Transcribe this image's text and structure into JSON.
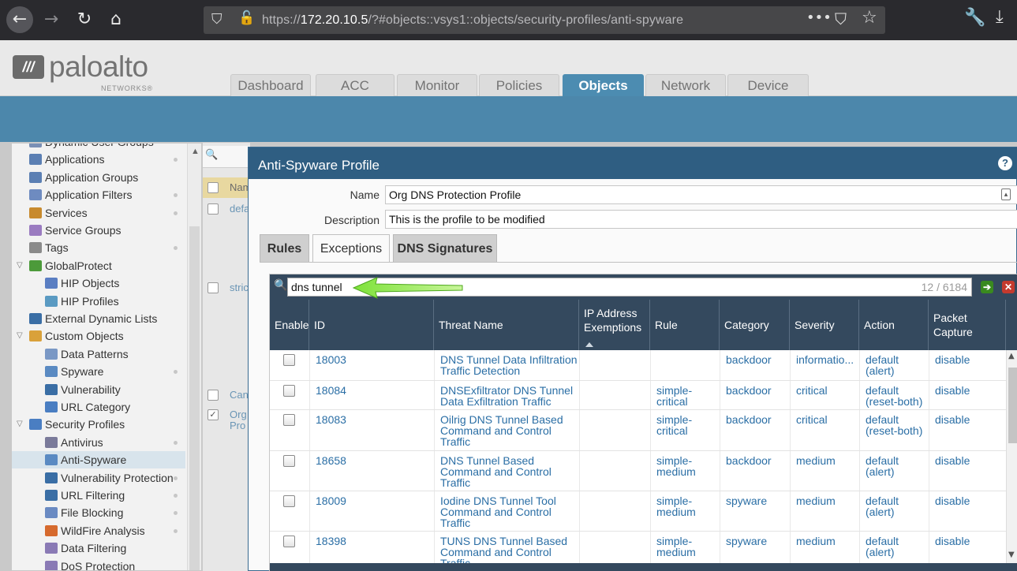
{
  "browser": {
    "url_prefix": "https://",
    "url_host": "172.20.10.5",
    "url_path": "/?#objects::vsys1::objects/security-profiles/anti-spyware",
    "icons": [
      "back-icon",
      "forward-icon",
      "reload-icon",
      "home-icon",
      "shield-icon",
      "lock-warning-icon",
      "more-icon",
      "pocket-icon",
      "star-icon",
      "wrench-icon",
      "download-icon"
    ]
  },
  "header": {
    "logo_text": "paloalto",
    "logo_sub": "NETWORKS®",
    "tabs": [
      {
        "label": "Dashboard"
      },
      {
        "label": "ACC"
      },
      {
        "label": "Monitor"
      },
      {
        "label": "Policies"
      },
      {
        "label": "Objects",
        "active": true
      },
      {
        "label": "Network"
      },
      {
        "label": "Device"
      }
    ]
  },
  "tree": {
    "items": [
      {
        "label": "Dynamic User Groups",
        "icon": "user-group-icon"
      },
      {
        "label": "Applications",
        "icon": "application-icon"
      },
      {
        "label": "Application Groups",
        "icon": "application-group-icon"
      },
      {
        "label": "Application Filters",
        "icon": "application-filter-icon"
      },
      {
        "label": "Services",
        "icon": "service-icon"
      },
      {
        "label": "Service Groups",
        "icon": "service-group-icon"
      },
      {
        "label": "Tags",
        "icon": "tag-icon"
      },
      {
        "label": "GlobalProtect",
        "icon": "globalprotect-icon"
      },
      {
        "label": "HIP Objects",
        "icon": "hip-object-icon"
      },
      {
        "label": "HIP Profiles",
        "icon": "hip-profile-icon"
      },
      {
        "label": "External Dynamic Lists",
        "icon": "external-list-icon"
      },
      {
        "label": "Custom Objects",
        "icon": "custom-object-icon"
      },
      {
        "label": "Data Patterns",
        "icon": "data-pattern-icon"
      },
      {
        "label": "Spyware",
        "icon": "spyware-icon"
      },
      {
        "label": "Vulnerability",
        "icon": "vulnerability-icon"
      },
      {
        "label": "URL Category",
        "icon": "url-category-icon"
      },
      {
        "label": "Security Profiles",
        "icon": "security-profile-icon"
      },
      {
        "label": "Antivirus",
        "icon": "antivirus-icon"
      },
      {
        "label": "Anti-Spyware",
        "icon": "anti-spyware-icon"
      },
      {
        "label": "Vulnerability Protection",
        "icon": "vulnerability-protection-icon"
      },
      {
        "label": "URL Filtering",
        "icon": "url-filtering-icon"
      },
      {
        "label": "File Blocking",
        "icon": "file-blocking-icon"
      },
      {
        "label": "WildFire Analysis",
        "icon": "wildfire-icon"
      },
      {
        "label": "Data Filtering",
        "icon": "data-filtering-icon"
      },
      {
        "label": "DoS Protection",
        "icon": "dos-protection-icon"
      }
    ]
  },
  "bglist": {
    "header": "Nam",
    "rows": [
      "defa",
      "stric",
      "Can",
      "Org Pro"
    ]
  },
  "dialog": {
    "title": "Anti-Spyware Profile",
    "name_label": "Name",
    "name_value": "Org DNS Protection Profile",
    "description_label": "Description",
    "description_value": "This is the profile to be modified",
    "tabs": [
      "Rules",
      "Exceptions",
      "DNS Signatures"
    ],
    "search_value": "dns tunnel",
    "search_count": "12 / 6184",
    "columns": [
      "Enable",
      "ID",
      "Threat Name",
      "IP Address Exemptions",
      "Rule",
      "Category",
      "Severity",
      "Action",
      "Packet Capture"
    ],
    "rows": [
      {
        "id": "18003",
        "threat": "DNS Tunnel Data Infiltration Traffic Detection",
        "rule": "",
        "category": "backdoor",
        "severity": "informatio...",
        "action": "default (alert)",
        "capture": "disable"
      },
      {
        "id": "18084",
        "threat": "DNSExfiltrator DNS Tunnel Data Exfiltration Traffic",
        "rule": "simple-critical",
        "category": "backdoor",
        "severity": "critical",
        "action": "default (reset-both)",
        "capture": "disable"
      },
      {
        "id": "18083",
        "threat": "Oilrig DNS Tunnel Based Command and Control Traffic",
        "rule": "simple-critical",
        "category": "backdoor",
        "severity": "critical",
        "action": "default (reset-both)",
        "capture": "disable"
      },
      {
        "id": "18658",
        "threat": "DNS Tunnel Based Command and Control Traffic",
        "rule": "simple-medium",
        "category": "backdoor",
        "severity": "medium",
        "action": "default (alert)",
        "capture": "disable"
      },
      {
        "id": "18009",
        "threat": "Iodine DNS Tunnel Tool Command and Control Traffic",
        "rule": "simple-medium",
        "category": "spyware",
        "severity": "medium",
        "action": "default (alert)",
        "capture": "disable"
      },
      {
        "id": "18398",
        "threat": "TUNS DNS Tunnel Based Command and Control Traffic",
        "rule": "simple-medium",
        "category": "spyware",
        "severity": "medium",
        "action": "default (alert)",
        "capture": "disable"
      }
    ]
  }
}
